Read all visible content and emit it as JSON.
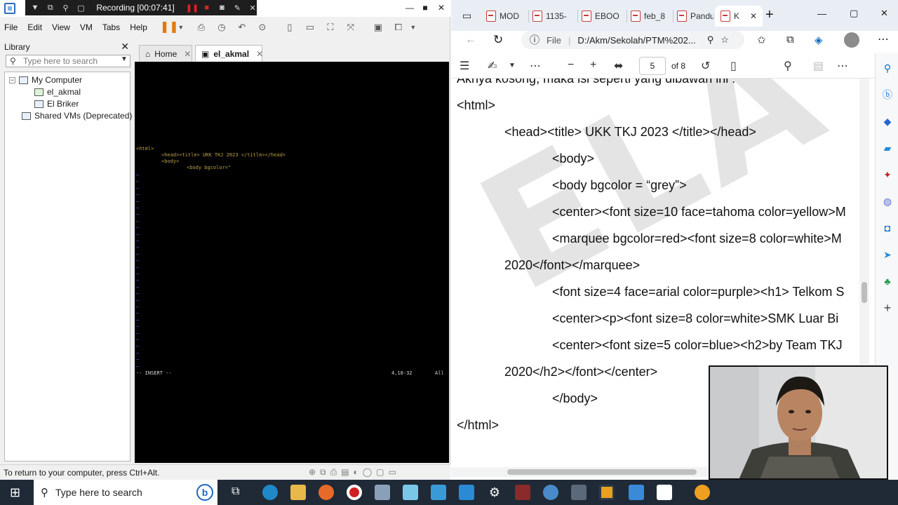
{
  "vmware": {
    "recording_label": "Recording [00:07:41]",
    "menu": [
      "File",
      "Edit",
      "View",
      "VM",
      "Tabs",
      "Help"
    ],
    "library_title": "Library",
    "search_placeholder": "Type here to search",
    "tree": {
      "root": "My Computer",
      "vms": [
        "el_akmal",
        "El Briker"
      ],
      "shared": "Shared VMs (Deprecated)"
    },
    "tabs": [
      {
        "label": "Home"
      },
      {
        "label": "el_akmal"
      }
    ],
    "console": {
      "line_html": "<html>",
      "line_head": "<head><title> UKK TKJ 2023 </title></head>",
      "line_body": "<body>",
      "line_bgcolor": "<body bgcolor=\"",
      "mode": "-- INSERT --",
      "position": "4,18-32",
      "scroll": "All"
    },
    "status": "To return to your computer, press Ctrl+Alt."
  },
  "edge": {
    "tabs": [
      "MOD",
      "1135-",
      "EBOO",
      "feb_8",
      "Pandu",
      "K"
    ],
    "address_prefix": "File",
    "address": "D:/Akm/Sekolah/PTM%202...",
    "page_current": "5",
    "page_total": "of 8",
    "pdf_lines": {
      "top_partial": "Aknya kosong, maka isi seperti yang dibawah ini :",
      "l1": "<html>",
      "l2": "<head><title> UKK TKJ 2023 </title></head>",
      "l3": "<body>",
      "l4": "<body bgcolor = “grey”>",
      "l5": "<center><font size=10 face=tahoma color=yellow>M",
      "l6": "<marquee bgcolor=red><font size=8 color=white>M",
      "l7": "2020</font></marquee>",
      "l8": "<font size=4 face=arial color=purple><h1> Telkom S",
      "l9": "<center><p><font size=8 color=white>SMK Luar Bi",
      "l10": "<center><font size=5 color=blue><h2>by Team TKJ",
      "l11": "2020</h2></font></center>",
      "l12": "</body>",
      "l13": "</html>"
    },
    "watermark": "ELA"
  },
  "taskbar": {
    "search_placeholder": "Type here to search"
  },
  "colors": {
    "vim_tag": "#b8a04a",
    "vim_text": "#d8d8d8",
    "vim_string": "#c060c0",
    "taskbar": "#1f2a36",
    "edge_accent": "#0f6cbd",
    "pause_orange": "#e07a10"
  }
}
